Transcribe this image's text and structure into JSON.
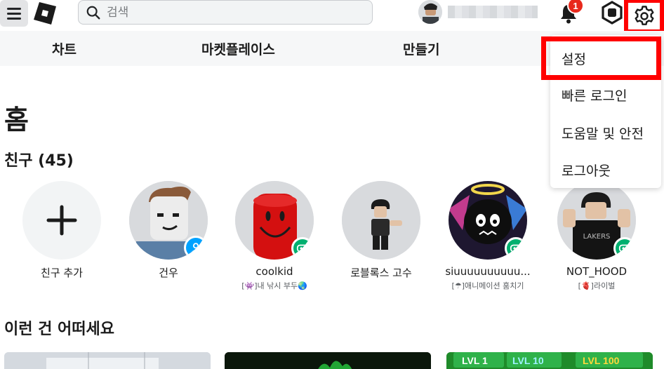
{
  "search": {
    "placeholder": "검색"
  },
  "header": {
    "notification_count": "1"
  },
  "nav": {
    "items": [
      {
        "label": "차트"
      },
      {
        "label": "마켓플레이스"
      },
      {
        "label": "만들기"
      }
    ]
  },
  "home": {
    "title": "홈"
  },
  "friends": {
    "heading": "친구 (45)",
    "add_label": "친구 추가",
    "list": [
      {
        "name": "건우",
        "game": ""
      },
      {
        "name": "coolkid",
        "game": "[👾]내 낚시 부두🌏"
      },
      {
        "name": "로블록스 고수",
        "game": ""
      },
      {
        "name": "siuuuuuuuuuu...",
        "game": "[☂]애니메이션 훔치기"
      },
      {
        "name": "NOT_HOOD",
        "game": "[🫀]라이벌"
      }
    ]
  },
  "recommend": {
    "title": "이런 건 어떠세요",
    "card3_labels": [
      "LVL 1",
      "LVL 10",
      "LVL 100"
    ]
  },
  "dropdown": {
    "items": [
      {
        "label": "설정"
      },
      {
        "label": "빠른 로그인"
      },
      {
        "label": "도움말 및 안전"
      },
      {
        "label": "로그아웃"
      }
    ]
  },
  "colors": {
    "highlight_red": "#ff0000",
    "game_status_green": "#00b06f",
    "online_status_blue": "#00a2ff",
    "badge_red": "#e8291c"
  }
}
